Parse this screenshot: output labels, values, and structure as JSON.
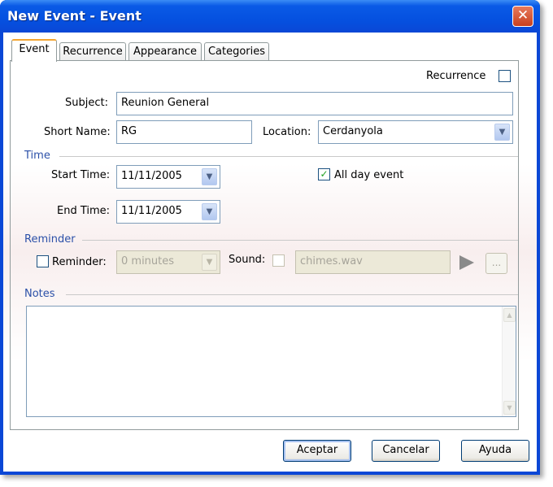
{
  "window": {
    "title": "New Event - Event",
    "close_symbol": "✕"
  },
  "tabs": [
    {
      "label": "Event",
      "active": true
    },
    {
      "label": "Recurrence",
      "active": false
    },
    {
      "label": "Appearance",
      "active": false
    },
    {
      "label": "Categories",
      "active": false
    }
  ],
  "recurrence": {
    "label": "Recurrence",
    "checked": false
  },
  "subject": {
    "label": "Subject:",
    "value": "Reunion General"
  },
  "short_name": {
    "label": "Short Name:",
    "value": "RG"
  },
  "location": {
    "label": "Location:",
    "value": "Cerdanyola"
  },
  "time_section": {
    "label": "Time"
  },
  "start_time": {
    "label": "Start Time:",
    "value": "11/11/2005"
  },
  "end_time": {
    "label": "End Time:",
    "value": "11/11/2005"
  },
  "all_day": {
    "label": "All day event",
    "checked": true,
    "check_symbol": "✓"
  },
  "reminder_section": {
    "label": "Reminder"
  },
  "reminder": {
    "label": "Reminder:",
    "checked": false,
    "value": "0 minutes"
  },
  "sound": {
    "label": "Sound:",
    "checked": false,
    "value": "chimes.wav",
    "browse_label": "..."
  },
  "notes_section": {
    "label": "Notes"
  },
  "notes": {
    "value": ""
  },
  "buttons": {
    "accept": "Aceptar",
    "cancel": "Cancelar",
    "help": "Ayuda"
  },
  "colors": {
    "title_bar": "#0a5ae6",
    "section_text": "#2b50a8",
    "check_mark": "#21a121"
  },
  "icons": {
    "dropdown": "▼",
    "scroll_up": "▲",
    "scroll_down": "▼"
  }
}
